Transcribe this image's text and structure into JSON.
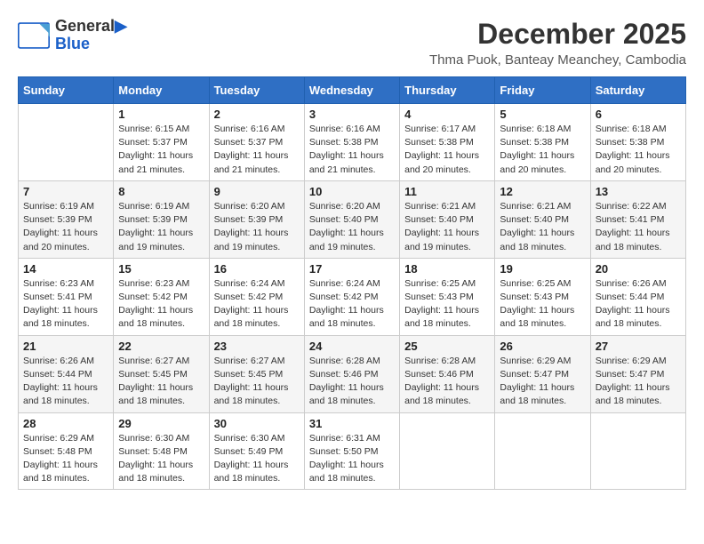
{
  "logo": {
    "line1": "General",
    "line2": "Blue"
  },
  "title": "December 2025",
  "subtitle": "Thma Puok, Banteay Meanchey, Cambodia",
  "days_header": [
    "Sunday",
    "Monday",
    "Tuesday",
    "Wednesday",
    "Thursday",
    "Friday",
    "Saturday"
  ],
  "weeks": [
    [
      {
        "day": "",
        "info": ""
      },
      {
        "day": "1",
        "info": "Sunrise: 6:15 AM\nSunset: 5:37 PM\nDaylight: 11 hours\nand 21 minutes."
      },
      {
        "day": "2",
        "info": "Sunrise: 6:16 AM\nSunset: 5:37 PM\nDaylight: 11 hours\nand 21 minutes."
      },
      {
        "day": "3",
        "info": "Sunrise: 6:16 AM\nSunset: 5:38 PM\nDaylight: 11 hours\nand 21 minutes."
      },
      {
        "day": "4",
        "info": "Sunrise: 6:17 AM\nSunset: 5:38 PM\nDaylight: 11 hours\nand 20 minutes."
      },
      {
        "day": "5",
        "info": "Sunrise: 6:18 AM\nSunset: 5:38 PM\nDaylight: 11 hours\nand 20 minutes."
      },
      {
        "day": "6",
        "info": "Sunrise: 6:18 AM\nSunset: 5:38 PM\nDaylight: 11 hours\nand 20 minutes."
      }
    ],
    [
      {
        "day": "7",
        "info": "Sunrise: 6:19 AM\nSunset: 5:39 PM\nDaylight: 11 hours\nand 20 minutes."
      },
      {
        "day": "8",
        "info": "Sunrise: 6:19 AM\nSunset: 5:39 PM\nDaylight: 11 hours\nand 19 minutes."
      },
      {
        "day": "9",
        "info": "Sunrise: 6:20 AM\nSunset: 5:39 PM\nDaylight: 11 hours\nand 19 minutes."
      },
      {
        "day": "10",
        "info": "Sunrise: 6:20 AM\nSunset: 5:40 PM\nDaylight: 11 hours\nand 19 minutes."
      },
      {
        "day": "11",
        "info": "Sunrise: 6:21 AM\nSunset: 5:40 PM\nDaylight: 11 hours\nand 19 minutes."
      },
      {
        "day": "12",
        "info": "Sunrise: 6:21 AM\nSunset: 5:40 PM\nDaylight: 11 hours\nand 18 minutes."
      },
      {
        "day": "13",
        "info": "Sunrise: 6:22 AM\nSunset: 5:41 PM\nDaylight: 11 hours\nand 18 minutes."
      }
    ],
    [
      {
        "day": "14",
        "info": "Sunrise: 6:23 AM\nSunset: 5:41 PM\nDaylight: 11 hours\nand 18 minutes."
      },
      {
        "day": "15",
        "info": "Sunrise: 6:23 AM\nSunset: 5:42 PM\nDaylight: 11 hours\nand 18 minutes."
      },
      {
        "day": "16",
        "info": "Sunrise: 6:24 AM\nSunset: 5:42 PM\nDaylight: 11 hours\nand 18 minutes."
      },
      {
        "day": "17",
        "info": "Sunrise: 6:24 AM\nSunset: 5:42 PM\nDaylight: 11 hours\nand 18 minutes."
      },
      {
        "day": "18",
        "info": "Sunrise: 6:25 AM\nSunset: 5:43 PM\nDaylight: 11 hours\nand 18 minutes."
      },
      {
        "day": "19",
        "info": "Sunrise: 6:25 AM\nSunset: 5:43 PM\nDaylight: 11 hours\nand 18 minutes."
      },
      {
        "day": "20",
        "info": "Sunrise: 6:26 AM\nSunset: 5:44 PM\nDaylight: 11 hours\nand 18 minutes."
      }
    ],
    [
      {
        "day": "21",
        "info": "Sunrise: 6:26 AM\nSunset: 5:44 PM\nDaylight: 11 hours\nand 18 minutes."
      },
      {
        "day": "22",
        "info": "Sunrise: 6:27 AM\nSunset: 5:45 PM\nDaylight: 11 hours\nand 18 minutes."
      },
      {
        "day": "23",
        "info": "Sunrise: 6:27 AM\nSunset: 5:45 PM\nDaylight: 11 hours\nand 18 minutes."
      },
      {
        "day": "24",
        "info": "Sunrise: 6:28 AM\nSunset: 5:46 PM\nDaylight: 11 hours\nand 18 minutes."
      },
      {
        "day": "25",
        "info": "Sunrise: 6:28 AM\nSunset: 5:46 PM\nDaylight: 11 hours\nand 18 minutes."
      },
      {
        "day": "26",
        "info": "Sunrise: 6:29 AM\nSunset: 5:47 PM\nDaylight: 11 hours\nand 18 minutes."
      },
      {
        "day": "27",
        "info": "Sunrise: 6:29 AM\nSunset: 5:47 PM\nDaylight: 11 hours\nand 18 minutes."
      }
    ],
    [
      {
        "day": "28",
        "info": "Sunrise: 6:29 AM\nSunset: 5:48 PM\nDaylight: 11 hours\nand 18 minutes."
      },
      {
        "day": "29",
        "info": "Sunrise: 6:30 AM\nSunset: 5:48 PM\nDaylight: 11 hours\nand 18 minutes."
      },
      {
        "day": "30",
        "info": "Sunrise: 6:30 AM\nSunset: 5:49 PM\nDaylight: 11 hours\nand 18 minutes."
      },
      {
        "day": "31",
        "info": "Sunrise: 6:31 AM\nSunset: 5:50 PM\nDaylight: 11 hours\nand 18 minutes."
      },
      {
        "day": "",
        "info": ""
      },
      {
        "day": "",
        "info": ""
      },
      {
        "day": "",
        "info": ""
      }
    ]
  ]
}
